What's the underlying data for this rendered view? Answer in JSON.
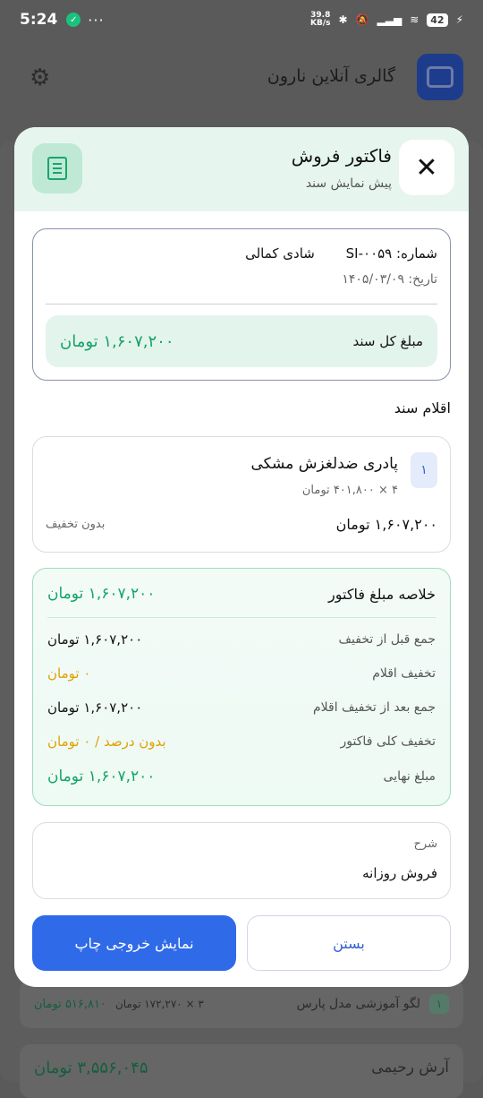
{
  "status_bar": {
    "time": "5:24",
    "dots": "···",
    "net_speed_value": "39.8",
    "net_speed_unit": "KB/s",
    "battery": "42"
  },
  "app_bar": {
    "title": "گالری آنلاین نارون"
  },
  "background_list": [
    {
      "num": "۱",
      "name": "لگو آموزشی مدل پارس",
      "detail": "۳ × ۱۷۲,۲۷۰ تومان",
      "amount": "۵۱۶,۸۱۰ تومان"
    },
    {
      "name": "آرش رحیمی",
      "amount": "۳,۵۵۶,۰۴۵ تومان"
    }
  ],
  "sheet": {
    "title": "فاکتور فروش",
    "subtitle": "پیش نمایش سند",
    "document": {
      "number_label": "شماره:",
      "number": "SI-۰۰۵۹",
      "customer": "شادی کمالی",
      "date_label": "تاریخ:",
      "date": "۱۴۰۵/۰۳/۰۹",
      "total_label": "مبلغ کل سند",
      "total": "۱,۶۰۷,۲۰۰ تومان"
    },
    "items_title": "اقلام سند",
    "items": [
      {
        "num": "۱",
        "name": "پادری ضدلغزش مشکی",
        "qty_line": "۴ × ۴۰۱,۸۰۰ تومان",
        "total": "۱,۶۰۷,۲۰۰ تومان",
        "discount": "بدون تخفیف"
      }
    ],
    "summary": {
      "title": "خلاصه مبلغ فاکتور",
      "title_amount": "۱,۶۰۷,۲۰۰ تومان",
      "rows": [
        {
          "label": "جمع قبل از تخفیف",
          "value": "۱,۶۰۷,۲۰۰ تومان"
        },
        {
          "label": "تخفیف اقلام",
          "value": "۰ تومان"
        },
        {
          "label": "جمع بعد از تخفیف اقلام",
          "value": "۱,۶۰۷,۲۰۰ تومان"
        },
        {
          "label": "تخفیف کلی فاکتور",
          "value": "بدون درصد / ۰ تومان"
        },
        {
          "label": "مبلغ نهایی",
          "value": "۱,۶۰۷,۲۰۰ تومان"
        }
      ],
      "colors": {
        "green": "#15a36a",
        "orange": "#e0a000"
      }
    },
    "description": {
      "label": "شرح",
      "value": "فروش روزانه"
    },
    "buttons": {
      "print": "نمایش خروجی چاپ",
      "close": "بستن"
    }
  }
}
